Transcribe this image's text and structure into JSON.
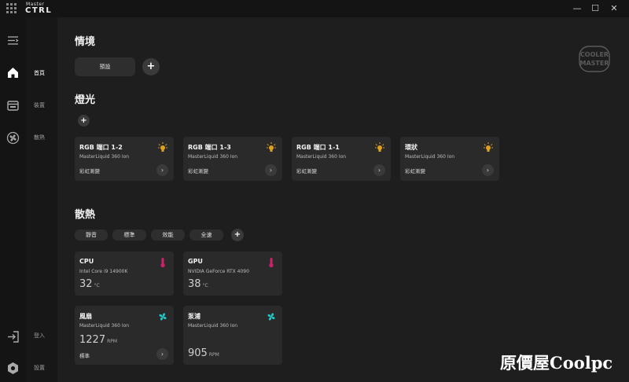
{
  "app": {
    "brand_small": "Master",
    "brand_big": "CTRL"
  },
  "window": {
    "minimize": "—",
    "maximize": "☐",
    "close": "✕"
  },
  "nav": {
    "home": "首頁",
    "devices": "裝置",
    "cooling": "散熱",
    "login": "登入",
    "settings": "設置"
  },
  "scenario": {
    "title": "情境",
    "preset_label": "預設",
    "add": "+"
  },
  "lighting": {
    "title": "燈光",
    "add": "+",
    "cards": [
      {
        "title": "RGB 端口 1-2",
        "device": "MasterLiquid 360 Ion",
        "mode": "彩虹漸變"
      },
      {
        "title": "RGB 端口 1-3",
        "device": "MasterLiquid 360 Ion",
        "mode": "彩虹漸變"
      },
      {
        "title": "RGB 端口 1-1",
        "device": "MasterLiquid 360 Ion",
        "mode": "彩虹漸變"
      },
      {
        "title": "環狀",
        "device": "MasterLiquid 360 Ion",
        "mode": "彩虹漸變"
      }
    ]
  },
  "cooling": {
    "title": "散熱",
    "profiles": [
      "靜音",
      "標準",
      "效能",
      "全速"
    ],
    "add": "+",
    "cards": [
      {
        "title": "CPU",
        "device": "Intel Core i9 14900K",
        "value": "32",
        "unit": "°C"
      },
      {
        "title": "GPU",
        "device": "NVIDIA GeForce RTX 4090",
        "value": "38",
        "unit": "°C"
      },
      {
        "title": "風扇",
        "device": "MasterLiquid 360 Ion",
        "value": "1227",
        "unit": "RPM",
        "mode": "標準"
      },
      {
        "title": "泵浦",
        "device": "MasterLiquid 360 Ion",
        "value": "905",
        "unit": "RPM"
      }
    ]
  },
  "watermark": "原價屋Coolpc",
  "colors": {
    "bulb": "#e0a020",
    "thermo": "#d0206a",
    "fan": "#20c8c8"
  },
  "icons": {
    "menu": "menu-icon",
    "home": "home-icon",
    "device": "device-icon",
    "fan_nav": "fan-icon",
    "login": "login-icon",
    "settings": "gear-icon",
    "bulb": "bulb-icon",
    "thermo": "thermometer-icon",
    "arrow": "chevron-right-icon"
  }
}
